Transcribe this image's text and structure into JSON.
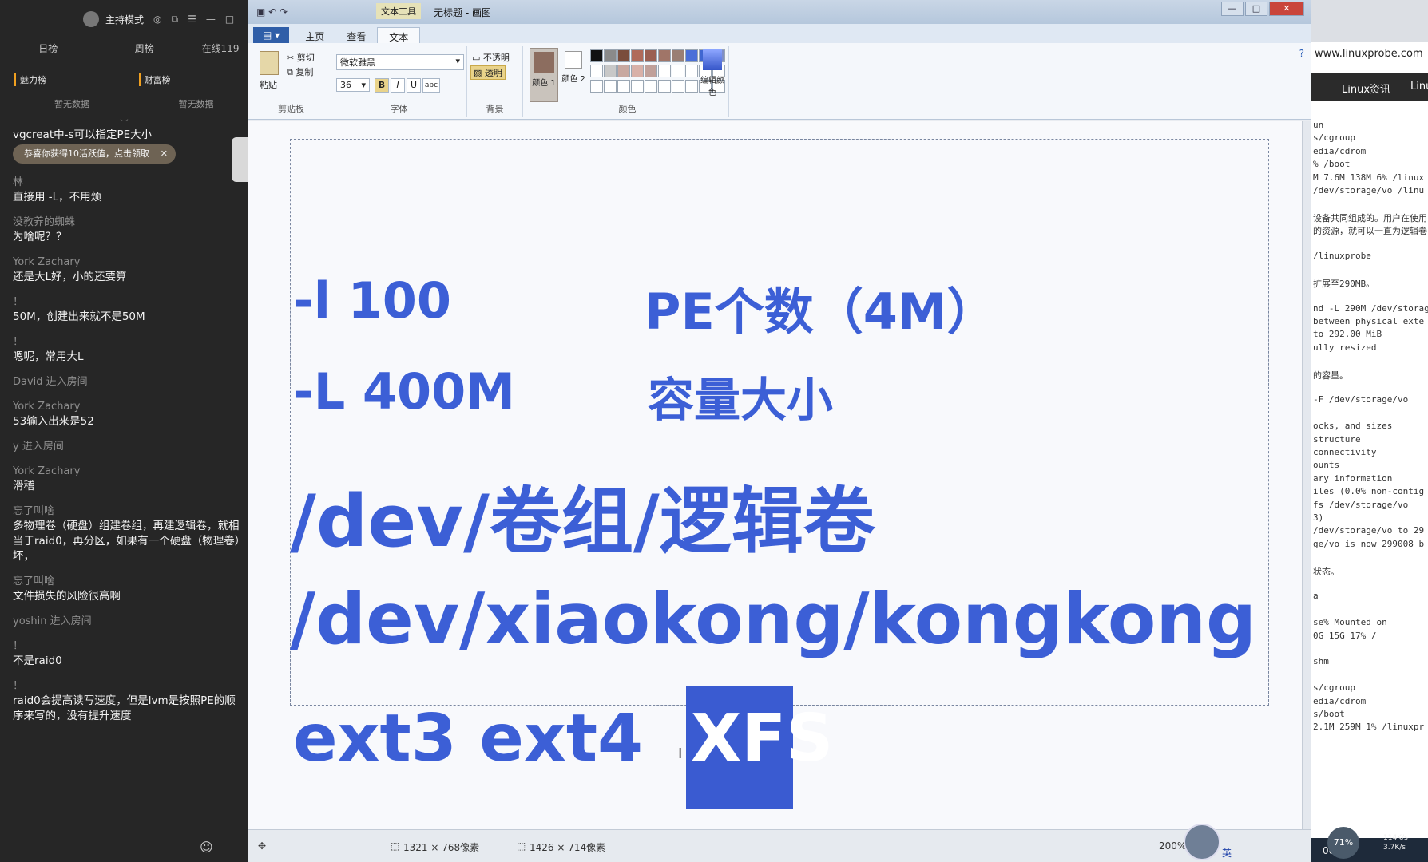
{
  "chat": {
    "title": "主持模式",
    "tabs": {
      "daily": "日榜",
      "weekly": "周榜",
      "online": "在线119"
    },
    "charm_rank": "魅力榜",
    "wealth_rank": "财富榜",
    "no_data": "暂无数据",
    "gift_toast": "恭喜你获得10活跃值，点击领取",
    "messages": [
      {
        "user": "",
        "text": "vgcreat中-s可以指定PE大小"
      },
      {
        "user": "",
        "text": ""
      },
      {
        "user": "林",
        "text": "直接用 -L，不用烦"
      },
      {
        "user": "没教养的蜘蛛",
        "text": "为啥呢？？"
      },
      {
        "user": "York Zachary",
        "text": "还是大L好，小的还要算"
      },
      {
        "user": "！",
        "text": "50M，创建出来就不是50M"
      },
      {
        "user": "！",
        "text": "嗯呢，常用大L"
      },
      {
        "user": "David 进入房间",
        "text": ""
      },
      {
        "user": "York Zachary",
        "text": "53输入出来是52"
      },
      {
        "user": "y 进入房间",
        "text": ""
      },
      {
        "user": "York Zachary",
        "text": "滑稽"
      },
      {
        "user": "忘了叫啥",
        "text": "多物理卷（硬盘）组建卷组，再建逻辑卷，就相当于raid0，再分区，如果有一个硬盘（物理卷）坏，"
      },
      {
        "user": "忘了叫啥",
        "text": "文件损失的风险很高啊"
      },
      {
        "user": "yoshin 进入房间",
        "text": ""
      },
      {
        "user": "！",
        "text": "不是raid0"
      },
      {
        "user": "！",
        "text": "raid0会提高读写速度，但是lvm是按照PE的顺序来写的，没有提升速度"
      }
    ]
  },
  "paint": {
    "context_tab": "文本工具",
    "window_title": "无标题 - 画图",
    "tabs": {
      "file": "",
      "home": "主页",
      "view": "查看",
      "text": "文本"
    },
    "clipboard": {
      "paste": "粘贴",
      "cut": "剪切",
      "copy": "复制",
      "label": "剪贴板"
    },
    "font": {
      "family": "微软雅黑",
      "size": "36",
      "label": "字体",
      "bold": "B",
      "italic": "I",
      "underline": "U",
      "strike": "abc"
    },
    "background": {
      "opaque": "不透明",
      "transparent": "透明",
      "label": "背景"
    },
    "colors": {
      "color1": "颜色 1",
      "color2": "颜色 2",
      "edit": "编辑颜色",
      "label": "颜色",
      "palette_top": [
        "#111111",
        "#8a8a8a",
        "#7a4d3c",
        "#b06a5a",
        "#9b5f52",
        "#a07568",
        "#9a7f74",
        "#4a6fd8",
        "#3f66d1",
        "#7f8fc8"
      ],
      "palette_bottom": [
        "#ffffff",
        "#c8c8c8",
        "#c8a8a0",
        "#d8b0a8",
        "#c0a09a",
        "#ffffff",
        "#ffffff",
        "#ffffff",
        "#ffffff",
        "#ffffff"
      ]
    },
    "canvas_text": {
      "line1_a": "-l   100",
      "line1_b": "PE个数（4M）",
      "line2_a": "-L  400M",
      "line2_b": "容量大小",
      "line3": "/dev/卷组/逻辑卷",
      "line4": "/dev/xiaokong/kongkong",
      "line5": "ext3 ext4",
      "selected": "XFS"
    },
    "status": {
      "selection_size": "1321 × 768像素",
      "image_size": "1426 × 714像素",
      "zoom": "200%"
    },
    "text_color": "#3c5fd6"
  },
  "browser": {
    "url": "www.linuxprobe.com",
    "nav": [
      "Linux资讯",
      "Linu"
    ],
    "terminal": [
      "un",
      "s/cgroup",
      "edia/cdrom",
      "% /boot",
      "M 7.6M 138M 6% /linux",
      "/dev/storage/vo /linu",
      "",
      "设备共同组成的。用户在使用",
      "的资源，就可以一直为逻辑卷",
      "",
      "/linuxprobe",
      "",
      "扩展至290MB。",
      "",
      "nd -L 290M /dev/storag",
      "between physical exte",
      "to 292.00 MiB",
      "ully resized",
      "",
      "的容量。",
      "",
      "-F /dev/storage/vo",
      "",
      "ocks, and sizes",
      "structure",
      "connectivity",
      "ounts",
      "ary information",
      "iles (0.0% non-contig",
      "fs /dev/storage/vo",
      "3)",
      "/dev/storage/vo to 29",
      "ge/vo is now 299008 b",
      "",
      "状态。",
      "",
      "a",
      "",
      "se% Mounted on",
      "0G 15G 17% /",
      "",
      "shm",
      "",
      "s/cgroup",
      "edia/cdrom",
      "s/boot",
      "2.1M 259M 1% /linuxpr"
    ]
  },
  "taskbar": {
    "lang": "英",
    "time": "00:41",
    "cpu": "71%",
    "net_up": "114K/s",
    "net_down": "3.7K/s"
  }
}
